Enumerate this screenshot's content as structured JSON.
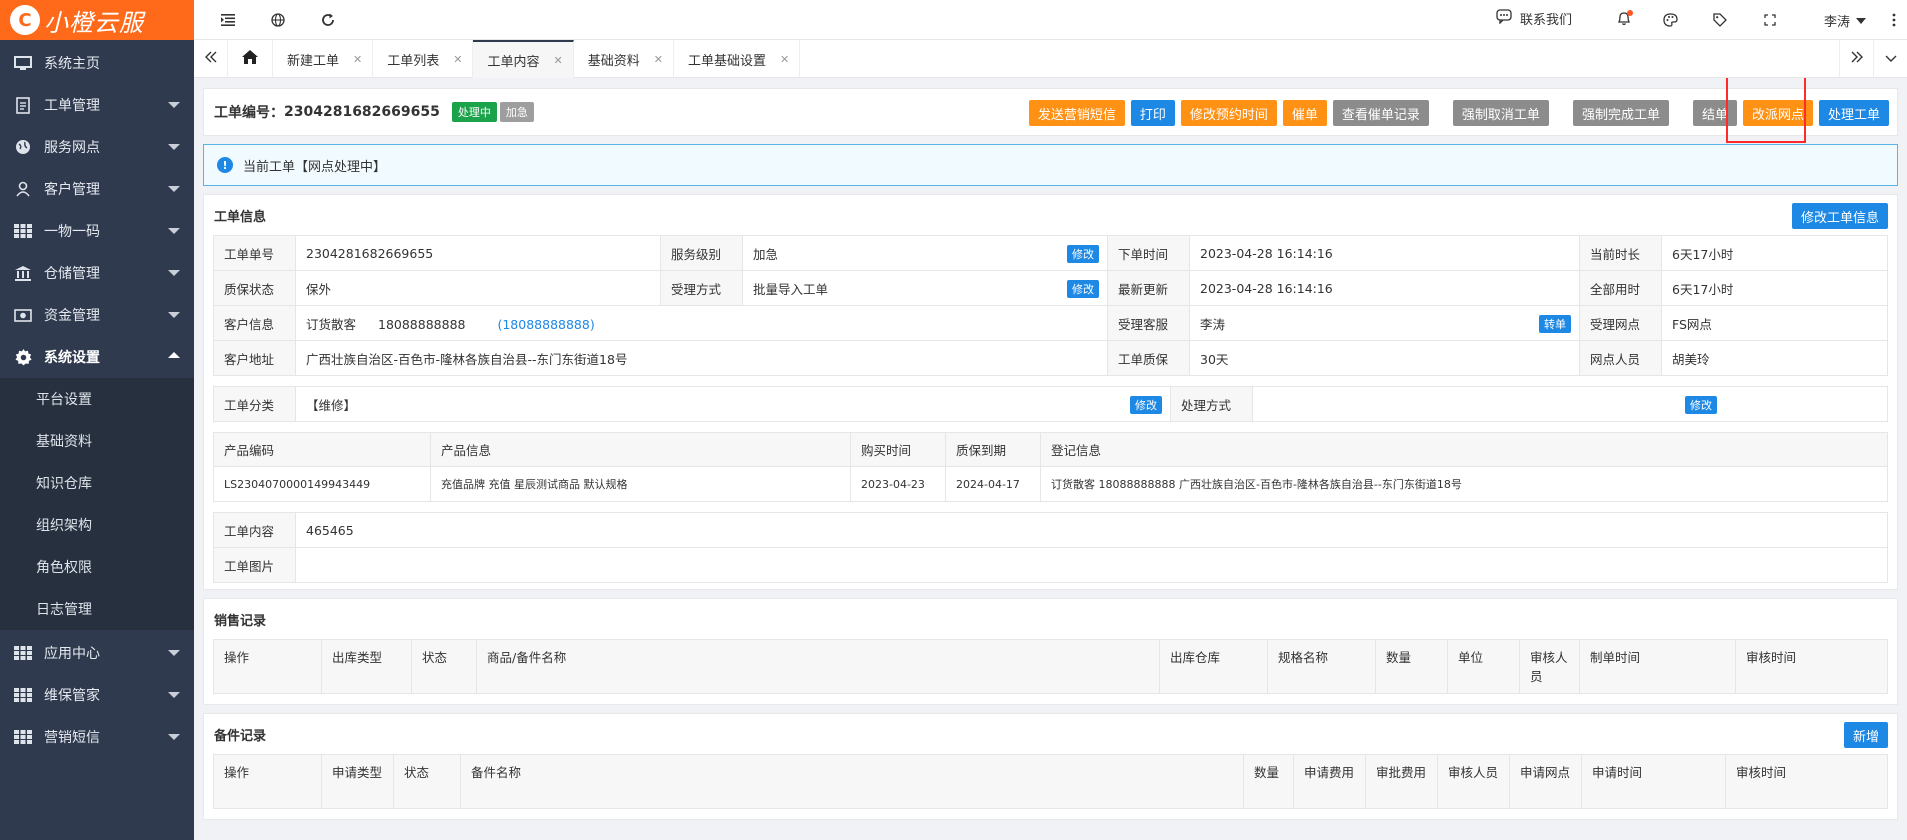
{
  "app": {
    "logo_char": "C",
    "logo_text": "小橙云服"
  },
  "sidebar": {
    "items": [
      {
        "label": "系统主页",
        "icon": "monitor-icon"
      },
      {
        "label": "工单管理",
        "icon": "document-icon"
      },
      {
        "label": "服务网点",
        "icon": "globe-icon"
      },
      {
        "label": "客户管理",
        "icon": "user-icon"
      },
      {
        "label": "一物一码",
        "icon": "grid-icon"
      },
      {
        "label": "仓储管理",
        "icon": "warehouse-icon"
      },
      {
        "label": "资金管理",
        "icon": "money-icon"
      },
      {
        "label": "系统设置",
        "icon": "gear-icon"
      }
    ],
    "submenu": [
      "平台设置",
      "基础资料",
      "知识仓库",
      "组织架构",
      "角色权限",
      "日志管理"
    ],
    "bottom_items": [
      {
        "label": "应用中心",
        "icon": "grid-icon"
      },
      {
        "label": "维保管家",
        "icon": "grid-icon"
      },
      {
        "label": "营销短信",
        "icon": "grid-icon"
      }
    ]
  },
  "topbar": {
    "contact": "联系我们",
    "user": "李涛"
  },
  "tabs": [
    "新建工单",
    "工单列表",
    "工单内容",
    "基础资料",
    "工单基础设置"
  ],
  "header": {
    "order_label": "工单编号：",
    "order_no": "2304281682669655",
    "status_badge": "处理中",
    "priority_badge": "加急",
    "actions": {
      "send_sms": "发送营销短信",
      "print": "打印",
      "modify_time": "修改预约时间",
      "urge": "催单",
      "view_urge": "查看催单记录",
      "force_cancel": "强制取消工单",
      "force_complete": "强制完成工单",
      "settle": "结单",
      "reassign": "改派网点",
      "process": "处理工单"
    }
  },
  "notice": "当前工单【网点处理中】",
  "info": {
    "title": "工单信息",
    "edit_button": "修改工单信息",
    "edit_small": "修改",
    "transfer_small": "转单",
    "labels": {
      "order_no": "工单单号",
      "service_level": "服务级别",
      "order_time": "下单时间",
      "current_duration": "当前时长",
      "warranty_status": "质保状态",
      "accept_method": "受理方式",
      "last_update": "最新更新",
      "total_duration": "全部用时",
      "customer_info": "客户信息",
      "accept_agent": "受理客服",
      "accept_outlet": "受理网点",
      "customer_address": "客户地址",
      "order_warranty": "工单质保",
      "outlet_staff": "网点人员",
      "category": "工单分类",
      "handling": "处理方式"
    },
    "values": {
      "order_no": "2304281682669655",
      "service_level": "加急",
      "order_time": "2023-04-28 16:14:16",
      "current_duration": "6天17小时",
      "warranty_status": "保外",
      "accept_method": "批量导入工单",
      "last_update": "2023-04-28 16:14:16",
      "total_duration": "6天17小时",
      "customer_name": "订货散客",
      "customer_phone": "18088888888",
      "customer_phone_link": "(18088888888)",
      "accept_agent": "李涛",
      "accept_outlet": "FS网点",
      "customer_address": "广西壮族自治区-百色市-隆林各族自治县--东门东街道18号",
      "order_warranty": "30天",
      "outlet_staff": "胡美玲",
      "category": "【维修】",
      "handling": ""
    }
  },
  "products": {
    "headers": [
      "产品编码",
      "产品信息",
      "购买时间",
      "质保到期",
      "登记信息"
    ],
    "rows": [
      [
        "LS2304070000149943449",
        "充值品牌 充值 星辰测试商品 默认规格",
        "2023-04-23",
        "2024-04-17",
        "订货散客 18088888888 广西壮族自治区-百色市-隆林各族自治县--东门东街道18号"
      ]
    ]
  },
  "content_section": {
    "content_label": "工单内容",
    "content_value": "465465",
    "image_label": "工单图片"
  },
  "sales": {
    "title": "销售记录",
    "headers": [
      "操作",
      "出库类型",
      "状态",
      "商品/备件名称",
      "出库仓库",
      "规格名称",
      "数量",
      "单位",
      "审核人员",
      "制单时间",
      "审核时间"
    ]
  },
  "parts": {
    "title": "备件记录",
    "add_button": "新增",
    "headers": [
      "操作",
      "申请类型",
      "状态",
      "备件名称",
      "数量",
      "申请费用",
      "审批费用",
      "审核人员",
      "申请网点",
      "申请时间",
      "审核时间"
    ]
  },
  "colors": {
    "orange": "#ff9114",
    "blue": "#1e88e5",
    "gray": "#8c8c8c",
    "green": "#1aa34a",
    "sidebar": "#2f3a4e"
  }
}
